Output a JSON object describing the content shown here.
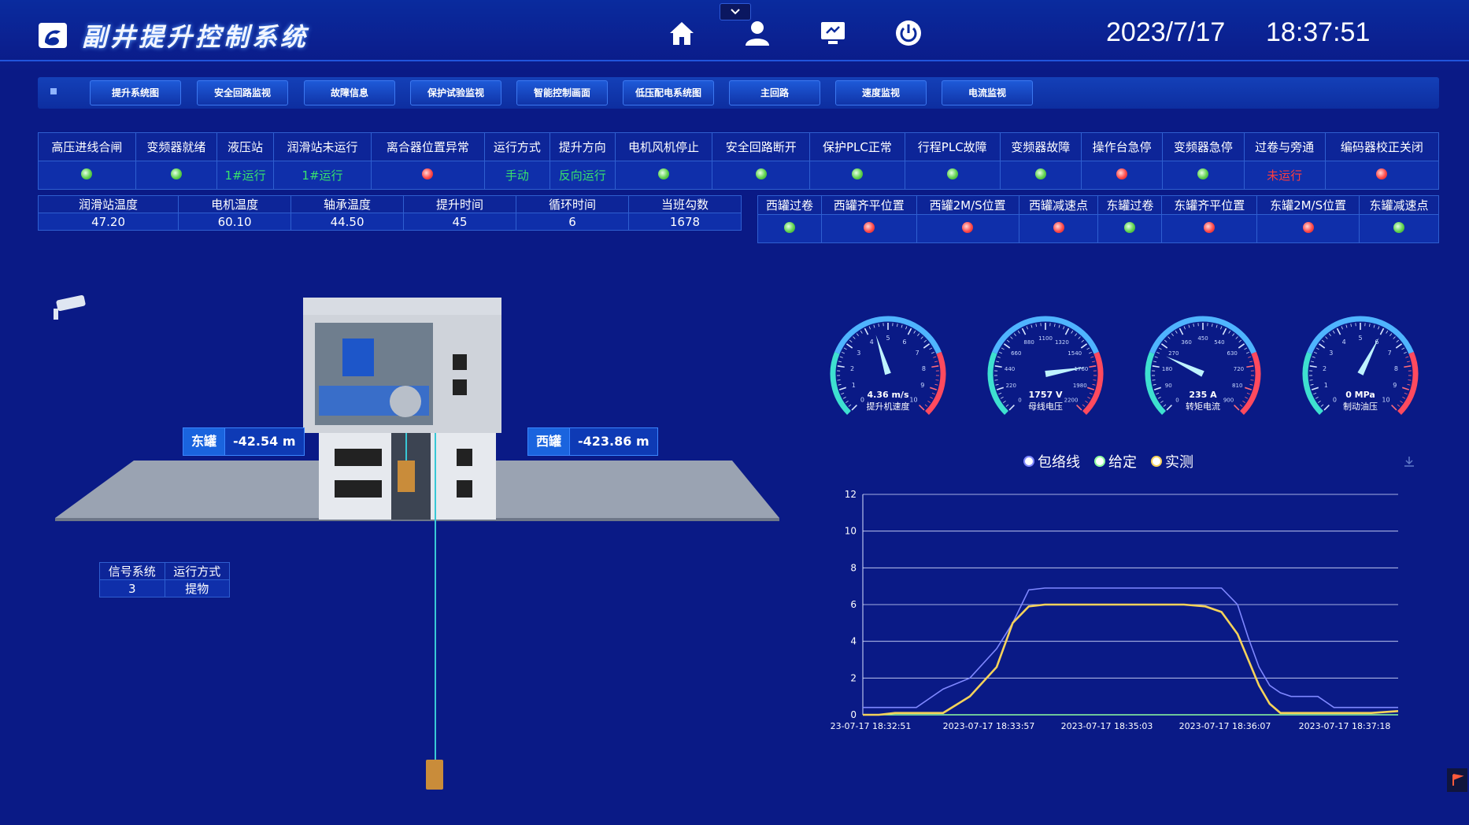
{
  "header": {
    "title": "副井提升控制系统",
    "date": "2023/7/17",
    "time": "18:37:51",
    "icons": [
      "home-icon",
      "user-icon",
      "monitor-icon",
      "power-icon"
    ]
  },
  "nav": {
    "items": [
      "提升系统图",
      "安全回路监视",
      "故障信息",
      "保护试验监视",
      "智能控制画面",
      "低压配电系统图",
      "主回路",
      "速度监视",
      "电流监视"
    ]
  },
  "status_table": {
    "headers": [
      "高压进线合闸",
      "变频器就绪",
      "液压站",
      "润滑站未运行",
      "离合器位置异常",
      "运行方式",
      "提升方向",
      "电机风机停止",
      "安全回路断开",
      "保护PLC正常",
      "行程PLC故障",
      "变频器故障",
      "操作台急停",
      "变频器急停",
      "过卷与旁通",
      "编码器校正关闭"
    ],
    "values": [
      {
        "type": "dot",
        "color": "green"
      },
      {
        "type": "dot",
        "color": "green"
      },
      {
        "type": "text",
        "text": "1#运行",
        "color": "green"
      },
      {
        "type": "text",
        "text": "1#运行",
        "color": "green"
      },
      {
        "type": "dot",
        "color": "red"
      },
      {
        "type": "text",
        "text": "手动",
        "color": "green"
      },
      {
        "type": "text",
        "text": "反向运行",
        "color": "green"
      },
      {
        "type": "dot",
        "color": "green"
      },
      {
        "type": "dot",
        "color": "green"
      },
      {
        "type": "dot",
        "color": "green"
      },
      {
        "type": "dot",
        "color": "green"
      },
      {
        "type": "dot",
        "color": "green"
      },
      {
        "type": "dot",
        "color": "red"
      },
      {
        "type": "dot",
        "color": "green"
      },
      {
        "type": "text",
        "text": "未运行",
        "color": "red"
      },
      {
        "type": "dot",
        "color": "red"
      }
    ]
  },
  "metrics": {
    "headers": [
      "润滑站温度",
      "电机温度",
      "轴承温度",
      "提升时间",
      "循环时间",
      "当班勾数"
    ],
    "values": [
      "47.20",
      "60.10",
      "44.50",
      "45",
      "6",
      "1678"
    ]
  },
  "positions": {
    "headers": [
      "西罐过卷",
      "西罐齐平位置",
      "西罐2M/S位置",
      "西罐减速点",
      "东罐过卷",
      "东罐齐平位置",
      "东罐2M/S位置",
      "东罐减速点"
    ],
    "values": [
      "green",
      "red",
      "red",
      "red",
      "green",
      "red",
      "red",
      "green"
    ]
  },
  "east_tag": {
    "label": "东罐",
    "value": "-42.54 m"
  },
  "west_tag": {
    "label": "西罐",
    "value": "-423.86 m"
  },
  "signal": {
    "h1": "信号系统",
    "h2": "运行方式",
    "v1": "3",
    "v2": "提物"
  },
  "gauges": [
    {
      "value_text": "4.36 m/s",
      "label": "提升机速度",
      "value": 4.36,
      "max": 10,
      "ticks": [
        "0",
        "1",
        "2",
        "3",
        "4",
        "5",
        "6",
        "7",
        "8",
        "9",
        "10"
      ]
    },
    {
      "value_text": "1757 V",
      "label": "母线电压",
      "value": 1757,
      "max": 2200,
      "ticks": [
        "0",
        "220",
        "440",
        "660",
        "880",
        "1100",
        "1320",
        "1540",
        "1760",
        "1980",
        "2200"
      ]
    },
    {
      "value_text": "235 A",
      "label": "转矩电流",
      "value": 235,
      "max": 900,
      "ticks": [
        "0",
        "90",
        "180",
        "270",
        "360",
        "450",
        "540",
        "630",
        "720",
        "810",
        "900"
      ]
    },
    {
      "value_text": "0 MPa",
      "label": "制动油压",
      "value": 6.0,
      "max": 10,
      "ticks": [
        "0",
        "1",
        "2",
        "3",
        "4",
        "5",
        "6",
        "7",
        "8",
        "9",
        "10"
      ]
    }
  ],
  "chart_data": {
    "type": "line",
    "legend": [
      "包络线",
      "给定",
      "实测"
    ],
    "x_labels": [
      "23-07-17 18:32:51",
      "2023-07-17 18:33:57",
      "2023-07-17 18:35:03",
      "2023-07-17 18:36:07",
      "2023-07-17 18:37:18"
    ],
    "y_ticks": [
      "0",
      "2",
      "4",
      "6",
      "8",
      "10",
      "12"
    ],
    "ylim": [
      0,
      12
    ],
    "x": [
      0,
      3,
      6,
      10,
      15,
      20,
      25,
      28,
      31,
      34,
      36,
      38,
      40,
      42,
      45,
      50,
      55,
      60,
      64,
      67,
      70,
      72,
      74,
      76,
      78,
      80,
      85,
      88,
      90,
      95,
      100
    ],
    "series": [
      {
        "name": "包络线",
        "color": "#7f88ff",
        "values": [
          0.4,
          0.4,
          0.4,
          0.4,
          1.4,
          2.0,
          3.6,
          5.0,
          6.8,
          6.9,
          6.9,
          6.9,
          6.9,
          6.9,
          6.9,
          6.9,
          6.9,
          6.9,
          6.9,
          6.9,
          6.0,
          4.2,
          2.6,
          1.6,
          1.2,
          1.0,
          1.0,
          0.4,
          0.4,
          0.4,
          0.4
        ]
      },
      {
        "name": "给定",
        "color": "#8fff9f",
        "values": [
          0,
          0,
          0,
          0,
          0,
          0,
          0,
          0,
          0,
          0,
          0,
          0,
          0,
          0,
          0,
          0,
          0,
          0,
          0,
          0,
          0,
          0,
          0,
          0,
          0,
          0,
          0,
          0,
          0,
          0,
          0
        ]
      },
      {
        "name": "实测",
        "color": "#f5d25a",
        "values": [
          0,
          0,
          0.1,
          0.1,
          0.1,
          1.0,
          2.6,
          5.0,
          5.9,
          6.0,
          6.0,
          6.0,
          6.0,
          6.0,
          6.0,
          6.0,
          6.0,
          6.0,
          5.9,
          5.6,
          4.4,
          3.0,
          1.6,
          0.6,
          0.1,
          0.1,
          0.1,
          0.1,
          0.1,
          0.1,
          0.2
        ]
      }
    ]
  }
}
